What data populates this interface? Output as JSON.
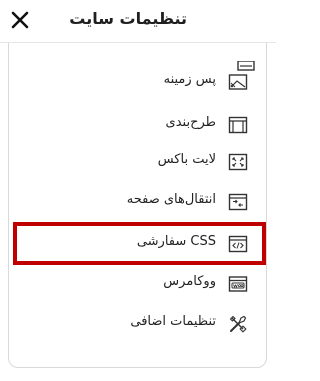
{
  "header": {
    "title": "تنظیمات سایت",
    "close_icon": "close-icon"
  },
  "items": [
    {
      "label": "پس زمینه",
      "icon": "background-icon"
    },
    {
      "label": "طرح‌بندی",
      "icon": "layout-icon"
    },
    {
      "label": "لایت باکس",
      "icon": "lightbox-icon"
    },
    {
      "label": "انتقال‌های صفحه",
      "icon": "page-transitions-icon"
    },
    {
      "label": "CSS سفارشی",
      "icon": "code-icon",
      "highlighted": true
    },
    {
      "label": "ووکامرس",
      "icon": "woocommerce-icon"
    },
    {
      "label": "تنظیمات اضافی",
      "icon": "tools-icon"
    }
  ],
  "colors": {
    "highlight": "#c00000",
    "border": "#d9d9d9",
    "text": "#222222"
  }
}
